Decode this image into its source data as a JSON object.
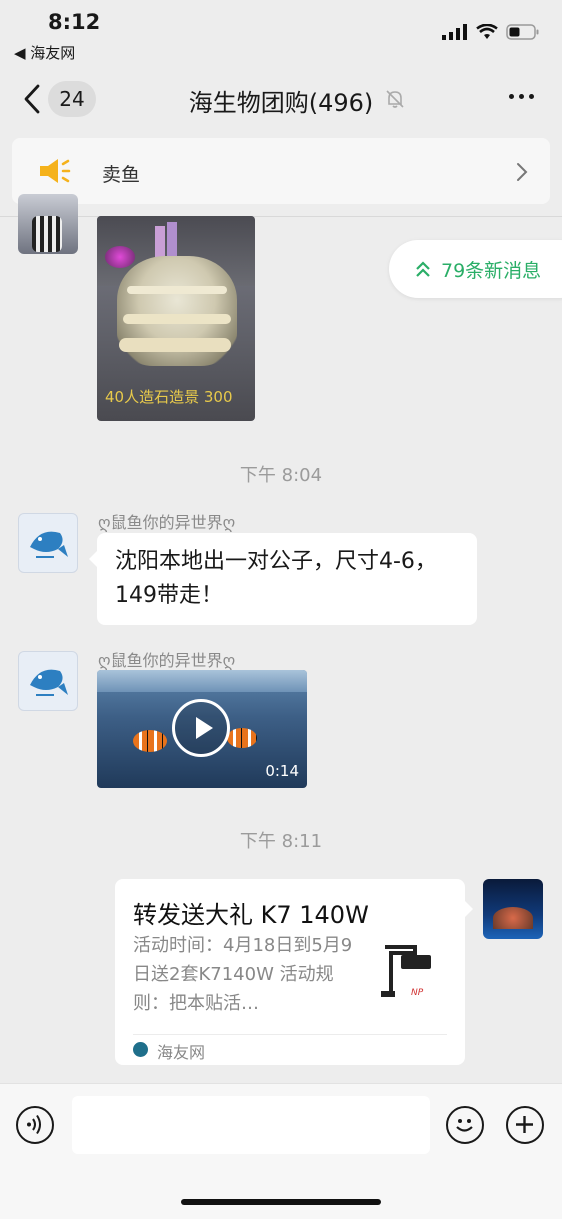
{
  "status_bar": {
    "time": "8:12",
    "back_app": "◀ 海友网"
  },
  "nav": {
    "unread_count": "24",
    "title": "海生物团购(496)"
  },
  "notice": {
    "text": "卖鱼"
  },
  "new_messages": {
    "text": "79条新消息"
  },
  "messages": {
    "photo_caption": "40人造石造景 300",
    "time1": "下午 8:04",
    "sender1": "ღ鼠鱼你的异世界ღ",
    "text1": "沈阳本地出一对公子，尺寸4-6，149带走！",
    "sender2": "ღ鼠鱼你的异世界ღ",
    "video_duration": "0:14",
    "time2": "下午 8:11",
    "card": {
      "title": "转发送大礼 K7 140W",
      "desc": "活动时间：4月18日到5月9日送2套K7140W 活动规则：把本贴活…",
      "source": "海友网"
    }
  },
  "colors": {
    "accent_green": "#2aae67",
    "background": "#ededed"
  }
}
